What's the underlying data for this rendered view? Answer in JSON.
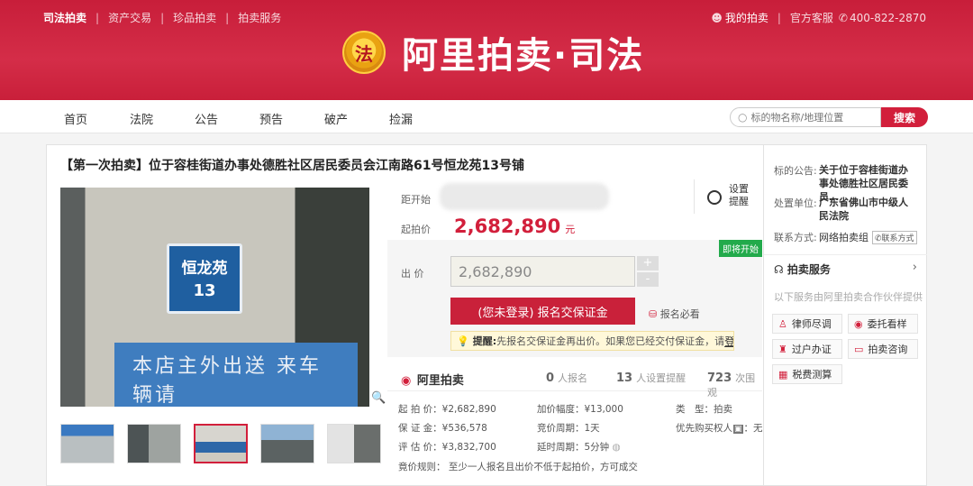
{
  "header": {
    "nav_left": [
      "司法拍卖",
      "资产交易",
      "珍品拍卖",
      "拍卖服务"
    ],
    "my_auction": "我的拍卖",
    "support_label": "官方客服",
    "support_phone": "400-822-2870",
    "logo_text": "阿里拍卖·司法",
    "emblem_char": "法"
  },
  "nav": {
    "items": [
      "首页",
      "法院",
      "公告",
      "预告",
      "破产",
      "捡漏"
    ],
    "search_placeholder": "标的物名称/地理位置",
    "search_button": "搜索"
  },
  "auction": {
    "title": "【第一次拍卖】位于容桂街道办事处德胜社区居民委员会江南路61号恒龙苑13号铺",
    "photo_sign_line1": "恒龙苑",
    "photo_sign_line2": "13",
    "photo_wall_text": "本店主外出送 来车辆请",
    "countdown_label": "距开始",
    "remind_line1": "设置",
    "remind_line2": "提醒",
    "start_label": "起拍价",
    "start_price": "2,682,890",
    "currency": "元",
    "status_badge": "即将开始",
    "bid_label": "出 价",
    "bid_value": "2,682,890",
    "plus": "+",
    "minus": "-",
    "apply_button": "(您未登录) 报名交保证金",
    "must_see": "报名必看",
    "tip_prefix": "提醒:",
    "tip_text": "先报名交保证金再出价。如果您已经交付保证金，请",
    "tip_login": "登录"
  },
  "stats": {
    "brand": "阿里拍卖",
    "signups_value": "0",
    "signups_label": "人报名",
    "reminders_value": "13",
    "reminders_label": "人设置提醒",
    "views_value": "723",
    "views_label": "次围观"
  },
  "details": {
    "start_price": "起 拍 价：¥2,682,890",
    "increment": "加价幅度：¥13,000",
    "type_label": "类　型：",
    "type_value": "拍卖",
    "deposit": "保 证 金：¥536,578",
    "period": "竞价周期：1天",
    "priority": "优先购买权人",
    "priority_value": "：无",
    "appraisal": "评 估 价：¥3,832,700",
    "delay": "延时周期：5分钟",
    "rule": "竟价规则：  至少一人报名且出价不低于起拍价，方可成交"
  },
  "side": {
    "notice_label": "标的公告:",
    "notice_value": "关于位于容桂街道办事处德胜社区居民委员…",
    "unit_label": "处置单位:",
    "unit_value": "广东省佛山市中级人民法院",
    "contact_label": "联系方式:",
    "contact_value": "网络拍卖组",
    "contact_tag": "联系方式",
    "services_title": "拍卖服务",
    "services_desc": "以下服务由阿里拍卖合作伙伴提供",
    "services": [
      "律师尽调",
      "委托看样",
      "过户办证",
      "拍卖咨询",
      "税费测算"
    ]
  }
}
